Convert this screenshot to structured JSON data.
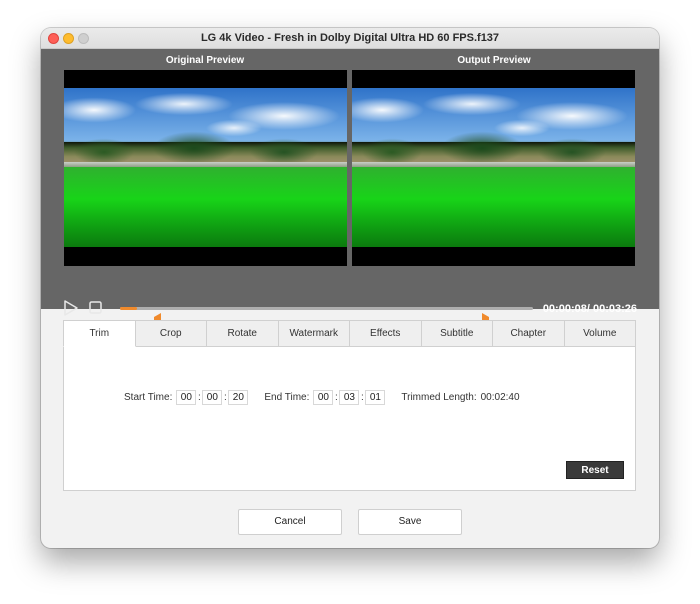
{
  "window": {
    "title": "LG 4k Video - Fresh in Dolby Digital Ultra HD 60 FPS.f137"
  },
  "preview": {
    "original_label": "Original Preview",
    "output_label": "Output  Preview"
  },
  "player": {
    "time_readout": "00:00:08/ 00:03:26",
    "progress_fraction": 0.04,
    "accent_color": "#f08a2c"
  },
  "tabs": [
    {
      "label": "Trim",
      "active": true
    },
    {
      "label": "Crop",
      "active": false
    },
    {
      "label": "Rotate",
      "active": false
    },
    {
      "label": "Watermark",
      "active": false
    },
    {
      "label": "Effects",
      "active": false
    },
    {
      "label": "Subtitle",
      "active": false
    },
    {
      "label": "Chapter",
      "active": false
    },
    {
      "label": "Volume",
      "active": false
    }
  ],
  "trim": {
    "start_label": "Start Time:",
    "start": {
      "h": "00",
      "m": "00",
      "s": "20"
    },
    "end_label": "End Time:",
    "end": {
      "h": "00",
      "m": "03",
      "s": "01"
    },
    "separator": ":",
    "trimmed_label": "Trimmed Length:",
    "trimmed_value": "00:02:40",
    "reset_label": "Reset"
  },
  "footer": {
    "cancel_label": "Cancel",
    "save_label": "Save"
  },
  "icons": {
    "play": "play-icon",
    "stop": "stop-icon",
    "marker": "trim-marker-icon"
  }
}
